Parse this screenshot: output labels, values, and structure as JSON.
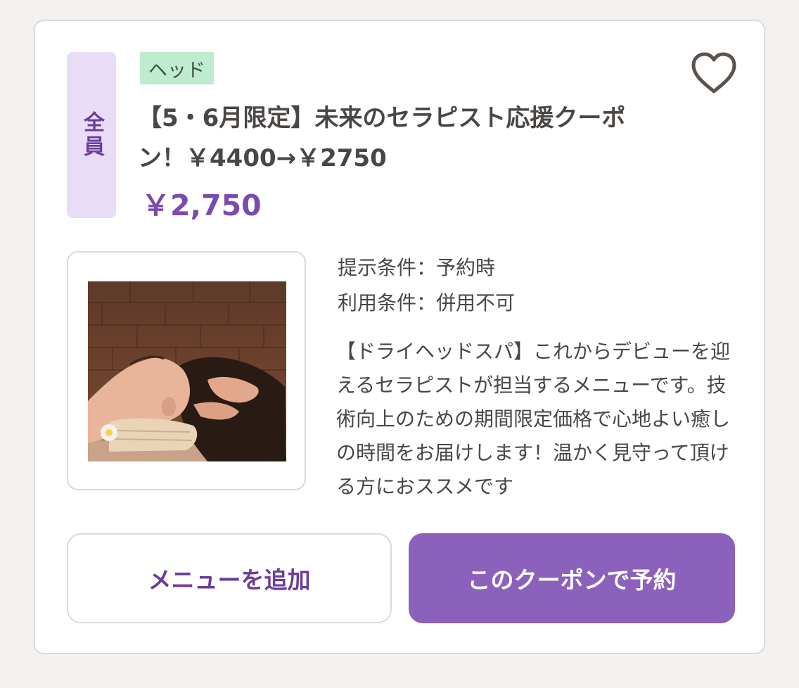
{
  "coupon": {
    "target_tag": "全員",
    "category_tag": "ヘッド",
    "title": "【5・6月限定】未来のセラピスト応援クーポン！￥4400→￥2750",
    "price": "￥2,750",
    "favorite_icon": "heart-outline-icon",
    "image_alt": "head-spa-massage-photo",
    "conditions": [
      {
        "label": "提示条件：",
        "value": "予約時"
      },
      {
        "label": "利用条件：",
        "value": "併用不可"
      }
    ],
    "description": "【ドライヘッドスパ】これからデビューを迎えるセラピストが担当するメニューです。技術向上のための期間限定価格で心地よい癒しの時間をお届けします！温かく見守って頂ける方におススメです",
    "buttons": {
      "add_menu": "メニューを追加",
      "reserve": "このクーポンで予約"
    }
  },
  "colors": {
    "accent": "#8c61bb",
    "accent_text": "#6a3d9a",
    "target_tag_bg": "#e9dcf6",
    "category_tag_bg": "#bfebce"
  }
}
